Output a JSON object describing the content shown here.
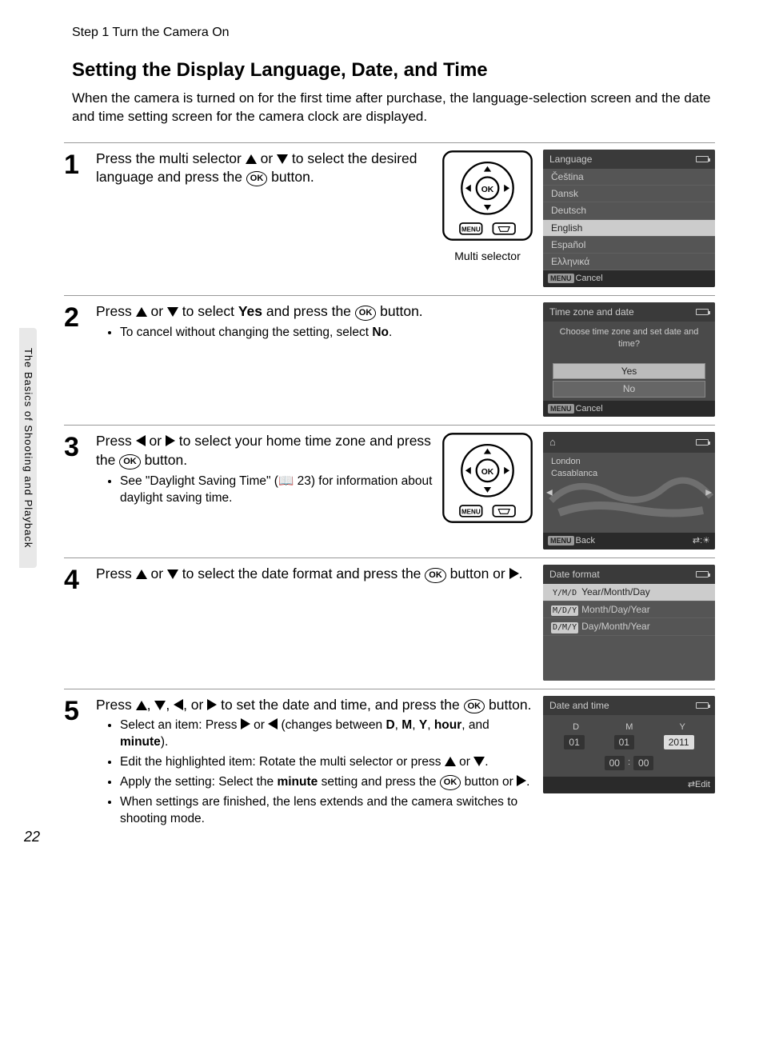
{
  "page": {
    "header_step": "Step 1 Turn the Camera On",
    "number": "22"
  },
  "sidebar": {
    "label": "The Basics of Shooting and Playback"
  },
  "title": "Setting the Display Language, Date, and Time",
  "intro": "When the camera is turned on for the first time after purchase, the language-selection screen and the date and time setting screen for the camera clock are displayed.",
  "steps": {
    "s1": {
      "num": "1",
      "text_a": "Press the multi selector ",
      "text_b": " or ",
      "text_c": " to select the desired language and press the ",
      "text_d": " button.",
      "caption": "Multi selector"
    },
    "s2": {
      "num": "2",
      "text_a": "Press ",
      "text_b": " or ",
      "text_c": " to select ",
      "yes": "Yes",
      "text_d": " and press the ",
      "text_e": " button.",
      "bullet_a": "To cancel without changing the setting, select ",
      "no": "No",
      "period": "."
    },
    "s3": {
      "num": "3",
      "text_a": "Press ",
      "text_b": " or ",
      "text_c": " to select your home time zone and press the ",
      "text_d": " button.",
      "bullet_a": "See \"Daylight Saving Time\" (",
      "ref": " 23) for information about daylight saving time."
    },
    "s4": {
      "num": "4",
      "text_a": "Press ",
      "text_b": " or ",
      "text_c": " to select the date format and press the ",
      "text_d": " button or ",
      "period": "."
    },
    "s5": {
      "num": "5",
      "text_a": "Press ",
      "comma": ", ",
      "text_or": ", or ",
      "text_b": " to set the date and time, and press the ",
      "text_c": " button.",
      "b1a": "Select an item: Press ",
      "b1b": " or ",
      "b1c": " (changes between ",
      "b1_D": "D",
      "b1_M": "M",
      "b1_Y": "Y",
      "b1_hour": "hour",
      "b1_minute": "minute",
      "b1_and": ", and ",
      "b1_end": ").",
      "b2a": "Edit the highlighted item: Rotate the multi selector or press ",
      "b2b": " or ",
      "b2c": ".",
      "b3a": "Apply the setting: Select the ",
      "b3_min": "minute",
      "b3b": " setting and press the ",
      "b3c": " button or ",
      "b3d": ".",
      "b4": "When settings are finished, the lens extends and the camera switches to shooting mode."
    }
  },
  "screens": {
    "lang": {
      "title": "Language",
      "items": [
        "Čeština",
        "Dansk",
        "Deutsch",
        "English",
        "Español",
        "Ελληνικά"
      ],
      "selected_index": 3,
      "cancel": "Cancel",
      "menu": "MENU"
    },
    "tz_confirm": {
      "title": "Time zone and date",
      "prompt": "Choose time zone and set date and time?",
      "yes": "Yes",
      "no": "No",
      "cancel": "Cancel",
      "menu": "MENU"
    },
    "tz_map": {
      "city1": "London",
      "city2": "Casablanca",
      "back": "Back",
      "menu": "MENU"
    },
    "df": {
      "title": "Date format",
      "opts": [
        {
          "key": "Y/M/D",
          "label": "Year/Month/Day"
        },
        {
          "key": "M/D/Y",
          "label": "Month/Day/Year"
        },
        {
          "key": "D/M/Y",
          "label": "Day/Month/Year"
        }
      ],
      "selected_index": 0
    },
    "dt": {
      "title": "Date and time",
      "D": "D",
      "M": "M",
      "Y": "Y",
      "d_val": "01",
      "m_val": "01",
      "y_val": "2011",
      "hh": "00",
      "mm": "00",
      "colon": ":",
      "edit": "Edit"
    }
  },
  "ok_label": "OK"
}
